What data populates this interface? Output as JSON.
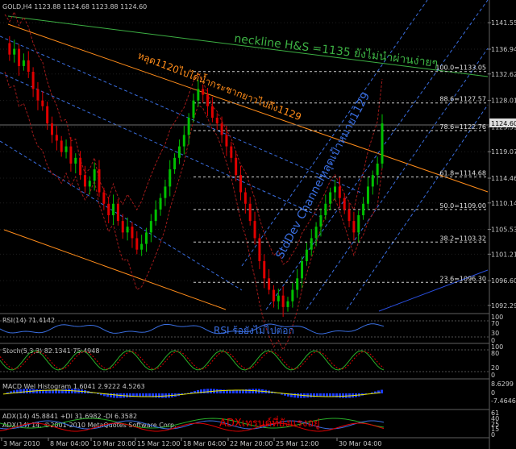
{
  "header": {
    "symbol_line": "GOLD,H4  1123.88 1124.68 1123.88 1124.60"
  },
  "colors": {
    "background": "#000000",
    "grid": "#2a2a2a",
    "bull": "#00c000",
    "bear": "#e00000",
    "neckline": "#3cb043",
    "trend_orange": "#ff8c1a",
    "channel_blue": "#3a6ee0",
    "bollinger": "#a01a1a",
    "annotation_neckline": "#3cb043",
    "annotation_trend": "#ff8c1a",
    "annotation_channel": "#3a6ee0",
    "annotation_rsi": "#3a6ee0",
    "annotation_adx": "#e00000",
    "axis_text": "#c8c8c8"
  },
  "annotations": {
    "neckline": "neckline H&S  =1135 ยังไม่นำผ่านง่ายๆ",
    "trend": "หลุด1120ไปได้น้ำกระชากยาวไปถึง1129",
    "channel": "StdDev Channelหลุดเป้าหมาย1129",
    "rsi": "RSI ร้อยังไม่ไปต่อก",
    "adx": "ADXเทรนด์ที่ยังแรงอยู่"
  },
  "fibonacci": [
    {
      "label": "100.0=1133.05",
      "value": 1133.05
    },
    {
      "label": "88.6=1127.57",
      "value": 1127.57
    },
    {
      "label": "78.6=1122.76",
      "value": 1122.76
    },
    {
      "label": "61.8=1114.68",
      "value": 1114.68
    },
    {
      "label": "50.0=1109.00",
      "value": 1109.0
    },
    {
      "label": "38.2=1103.32",
      "value": 1103.32
    },
    {
      "label": "23.6=1096.30",
      "value": 1096.3
    }
  ],
  "price_axis": {
    "ticks": [
      "1141.55",
      "1136.94",
      "1132.62",
      "1128.01",
      "1123.39",
      "1119.07",
      "1114.46",
      "1110.14",
      "1105.53",
      "1101.21",
      "1096.60",
      "1092.29"
    ],
    "current": "1124.60"
  },
  "time_axis": {
    "ticks": [
      "3 Mar 2010",
      "8 Mar 04:00",
      "10 Mar 20:00",
      "15 Mar 12:00",
      "18 Mar 04:00",
      "22 Mar 20:00",
      "25 Mar 12:00",
      "30 Mar 04:00"
    ]
  },
  "indicators": {
    "rsi": {
      "label": "RSI(14) 71.4142",
      "scale": [
        "100",
        "70",
        "30",
        "0"
      ]
    },
    "stoch": {
      "label": "Stoch(5,3,3) 82.1341 75.4948",
      "scale": [
        "100",
        "80",
        "20",
        "0"
      ]
    },
    "macd": {
      "label": "MACD Wel Histogram 1.6041 2.9222 4.5263",
      "scale": [
        "8.6299",
        "0",
        "-7.4646"
      ]
    },
    "adx": {
      "label": "ADX(14) 45.8841 +DI 31.6982 -DI 6.3582",
      "sublabel": "ADX(14) 14, ©2001-2010 MetaQuotes Software Corp.",
      "scale": [
        "61",
        "40",
        "25",
        "15",
        "0"
      ]
    }
  }
}
